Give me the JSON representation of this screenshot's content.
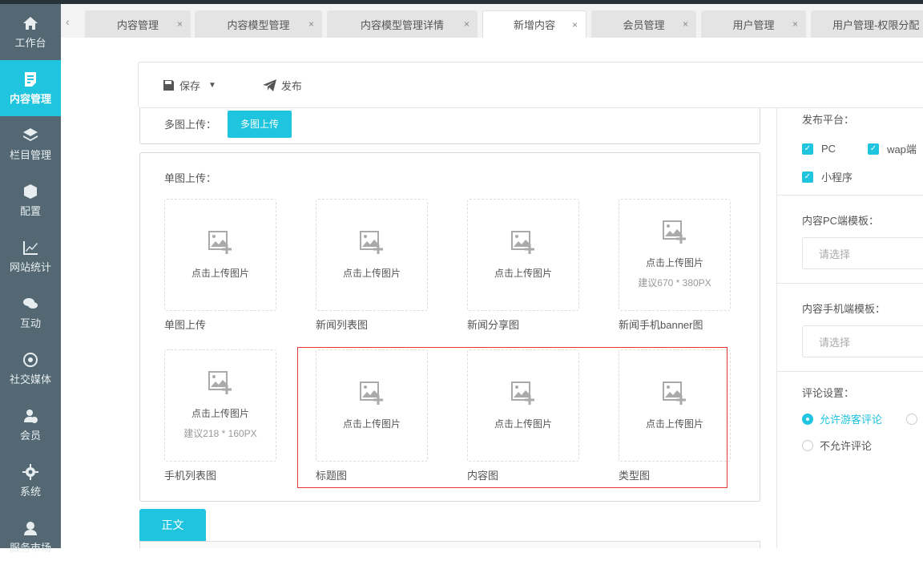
{
  "sidebar": {
    "items": [
      {
        "label": "工作台",
        "icon": "home-icon"
      },
      {
        "label": "内容管理",
        "icon": "document-icon",
        "active": true
      },
      {
        "label": "栏目管理",
        "icon": "layers-icon"
      },
      {
        "label": "配置",
        "icon": "cube-icon"
      },
      {
        "label": "网站统计",
        "icon": "chart-line-icon"
      },
      {
        "label": "互动",
        "icon": "chat-icon"
      },
      {
        "label": "社交媒体",
        "icon": "target-icon"
      },
      {
        "label": "会员",
        "icon": "member-icon"
      },
      {
        "label": "系统",
        "icon": "gear-icon"
      },
      {
        "label": "服务市场",
        "icon": "headset-icon"
      }
    ]
  },
  "tabs": [
    {
      "label": "内容管理"
    },
    {
      "label": "内容模型管理"
    },
    {
      "label": "内容模型管理详情"
    },
    {
      "label": "新增内容",
      "active": true
    },
    {
      "label": "会员管理"
    },
    {
      "label": "用户管理"
    },
    {
      "label": "用户管理-权限分配"
    }
  ],
  "toolbar": {
    "save": "保存",
    "publish": "发布"
  },
  "multi": {
    "label": "多图上传：",
    "button": "多图上传"
  },
  "single": {
    "label": "单图上传：",
    "upload_text": "点击上传图片",
    "items": [
      {
        "label": "单图上传",
        "hint": ""
      },
      {
        "label": "新闻列表图",
        "hint": ""
      },
      {
        "label": "新闻分享图",
        "hint": ""
      },
      {
        "label": "新闻手机banner图",
        "hint": "建议670 * 380PX"
      },
      {
        "label": "手机列表图",
        "hint": "建议218 * 160PX"
      },
      {
        "label": "标题图",
        "hint": ""
      },
      {
        "label": "内容图",
        "hint": ""
      },
      {
        "label": "类型图",
        "hint": ""
      }
    ]
  },
  "right": {
    "platform": {
      "label": "发布平台：",
      "options": [
        "PC",
        "wap端",
        "小程序"
      ]
    },
    "pc_template": {
      "label": "内容PC端模板：",
      "placeholder": "请选择"
    },
    "mobile_template": {
      "label": "内容手机端模板：",
      "placeholder": "请选择"
    },
    "comments": {
      "label": "评论设置：",
      "options": [
        "允许游客评论",
        "不允许评论"
      ]
    }
  },
  "editor_tab": "正文",
  "colors": {
    "accent": "#1fc4de",
    "sidebar": "#536872",
    "highlight": "#e53935"
  }
}
